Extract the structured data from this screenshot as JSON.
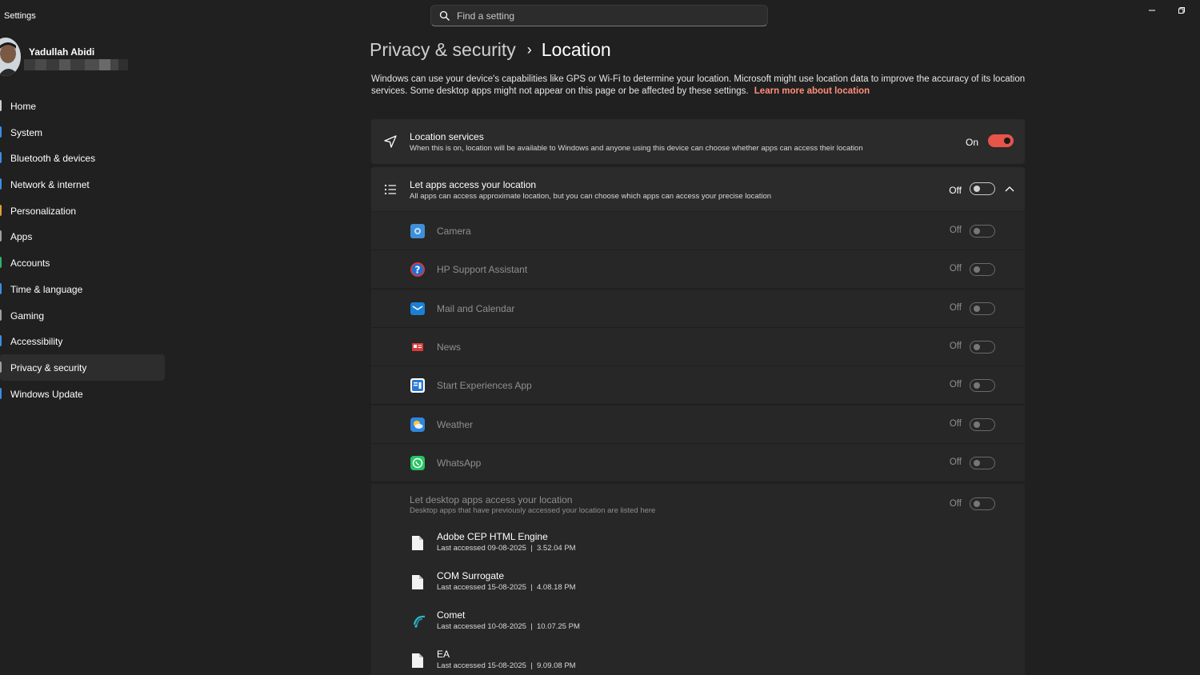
{
  "window": {
    "title": "Settings",
    "search_placeholder": "Find a setting"
  },
  "user": {
    "name": "Yadullah Abidi"
  },
  "sidebar": {
    "items": [
      {
        "label": "Home",
        "icon": "home-icon",
        "color": "#cfcfcf"
      },
      {
        "label": "System",
        "icon": "system-icon",
        "color": "#3a8ee6"
      },
      {
        "label": "Bluetooth & devices",
        "icon": "bluetooth-icon",
        "color": "#3a8ee6"
      },
      {
        "label": "Network & internet",
        "icon": "network-icon",
        "color": "#3a8ee6"
      },
      {
        "label": "Personalization",
        "icon": "personalization-icon",
        "color": "#e0a030"
      },
      {
        "label": "Apps",
        "icon": "apps-icon",
        "color": "#9aa0a6"
      },
      {
        "label": "Accounts",
        "icon": "accounts-icon",
        "color": "#2fb36a"
      },
      {
        "label": "Time & language",
        "icon": "time-language-icon",
        "color": "#3a8ee6"
      },
      {
        "label": "Gaming",
        "icon": "gaming-icon",
        "color": "#9aa0a6"
      },
      {
        "label": "Accessibility",
        "icon": "accessibility-icon",
        "color": "#3a8ee6"
      },
      {
        "label": "Privacy & security",
        "icon": "shield-icon",
        "color": "#9aa0a6",
        "active": true
      },
      {
        "label": "Windows Update",
        "icon": "windows-update-icon",
        "color": "#3a8ee6"
      }
    ]
  },
  "breadcrumb": {
    "parent": "Privacy & security",
    "separator": "›",
    "current": "Location"
  },
  "description": {
    "text": "Windows can use your device's capabilities like GPS or Wi-Fi to determine your location. Microsoft might use location data to improve the accuracy of its location services. Some desktop apps might not appear on this page or be affected by these settings.",
    "link": "Learn more about location"
  },
  "location_services": {
    "title": "Location services",
    "subtitle": "When this is on, location will be available to Windows and anyone using this device can choose whether apps can access their location",
    "state": "On",
    "enabled": true
  },
  "apps_access": {
    "title": "Let apps access your location",
    "subtitle": "All apps can access approximate location, but you can choose which apps can access your precise location",
    "state": "Off",
    "enabled": false,
    "expanded": true
  },
  "apps": [
    {
      "name": "Camera",
      "state": "Off",
      "icon": "camera-icon",
      "color": "#3f8fd8"
    },
    {
      "name": "HP Support Assistant",
      "state": "Off",
      "icon": "help-icon",
      "color": "#1e6fd9"
    },
    {
      "name": "Mail and Calendar",
      "state": "Off",
      "icon": "mail-icon",
      "color": "#1b7fd6"
    },
    {
      "name": "News",
      "state": "Off",
      "icon": "news-icon",
      "color": "#d83b3b"
    },
    {
      "name": "Start Experiences App",
      "state": "Off",
      "icon": "start-experiences-icon",
      "color": "#2a78d6"
    },
    {
      "name": "Weather",
      "state": "Off",
      "icon": "weather-icon",
      "color": "#2f86de"
    },
    {
      "name": "WhatsApp",
      "state": "Off",
      "icon": "whatsapp-icon",
      "color": "#25c563"
    }
  ],
  "desktop_apps": {
    "title": "Let desktop apps access your location",
    "subtitle": "Desktop apps that have previously accessed your location are listed here",
    "state": "Off",
    "items": [
      {
        "name": "Adobe CEP HTML Engine",
        "last": "Last accessed 09-08-2025  |  3.52.04 PM",
        "icon": "file-icon"
      },
      {
        "name": "COM Surrogate",
        "last": "Last accessed 15-08-2025  |  4.08.18 PM",
        "icon": "file-icon"
      },
      {
        "name": "Comet",
        "last": "Last accessed 10-08-2025  |  10.07.25 PM",
        "icon": "comet-icon"
      },
      {
        "name": "EA",
        "last": "Last accessed 15-08-2025  |  9.09.08 PM",
        "icon": "file-icon"
      }
    ]
  },
  "colors": {
    "background": "#202020",
    "card": "#2b2b2b",
    "accent": "#e7544a",
    "link": "#ff8e7a"
  }
}
